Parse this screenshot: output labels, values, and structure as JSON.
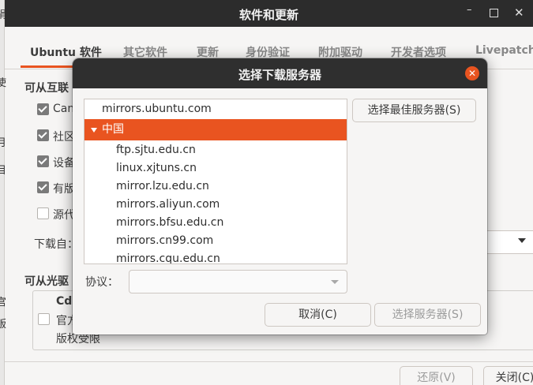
{
  "window": {
    "title": "软件和更新",
    "controls": {
      "minimize": "–",
      "maximize": "",
      "close": "✕"
    }
  },
  "left_edge_fragments": [
    "捐",
    "使",
    "月",
    "目",
    "i",
    "宫",
    "贩"
  ],
  "tabs": [
    {
      "label": "Ubuntu 软件",
      "active": true
    },
    {
      "label": "其它软件"
    },
    {
      "label": "更新"
    },
    {
      "label": "身份验证"
    },
    {
      "label": "附加驱动"
    },
    {
      "label": "开发者选项"
    },
    {
      "label": "Livepatch"
    }
  ],
  "internet_section": {
    "title": "可从互联",
    "checkboxes": [
      {
        "label": "Can",
        "checked": true
      },
      {
        "label": "社区",
        "checked": true
      },
      {
        "label": "设备",
        "checked": true
      },
      {
        "label": "有版",
        "checked": true
      },
      {
        "label": "源代",
        "checked": false
      }
    ],
    "download_from_label": "下载自："
  },
  "cdrom_section": {
    "title": "可从光驱",
    "item_title": "Cdr",
    "item_line2": "官方",
    "item_line3": "版权受限",
    "checked": false
  },
  "footer": {
    "revert_label": "还原(V)",
    "close_label": "关闭(C)"
  },
  "dialog": {
    "title": "选择下载服务器",
    "close_icon": "✕",
    "servers": {
      "main": "mirrors.ubuntu.com",
      "group": "中国",
      "children": [
        "ftp.sjtu.edu.cn",
        "linux.xjtuns.cn",
        "mirror.lzu.edu.cn",
        "mirrors.aliyun.com",
        "mirrors.bfsu.edu.cn",
        "mirrors.cn99.com",
        "mirrors.cqu.edu.cn"
      ]
    },
    "best_server_label": "选择最佳服务器(S)",
    "protocol_label": "协议：",
    "protocol_value": "",
    "cancel_label": "取消(C)",
    "choose_label": "选择服务器(S)"
  },
  "colors": {
    "accent": "#e95420",
    "titlebar": "#2f2f2f"
  }
}
